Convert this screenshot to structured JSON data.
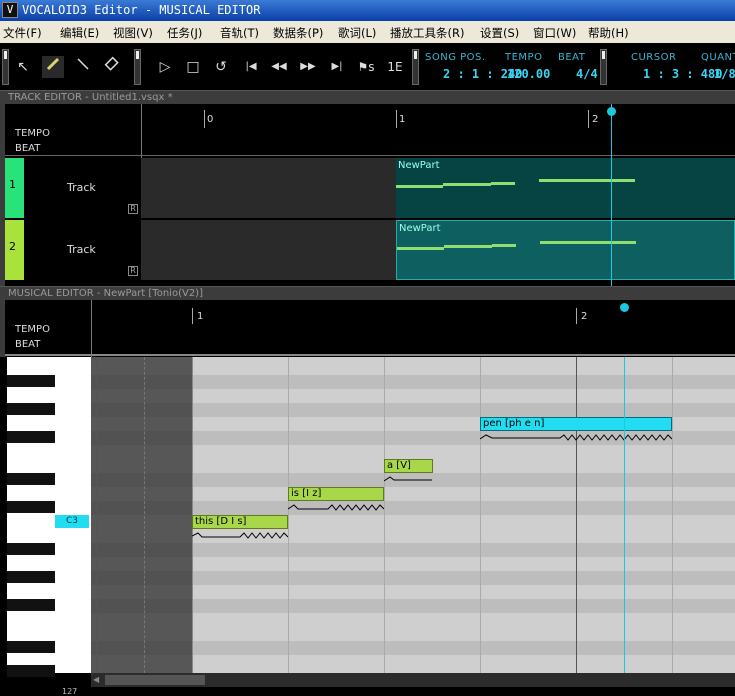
{
  "titlebar": {
    "title": "VOCALOID3 Editor - MUSICAL EDITOR",
    "logo": "V"
  },
  "menu": [
    "文件(F)",
    "编辑(E)",
    "视图(V)",
    "任务(J)",
    "音轨(T)",
    "数据条(P)",
    "歌词(L)",
    "播放工具条(R)",
    "设置(S)",
    "窗口(W)",
    "帮助(H)"
  ],
  "transport": {
    "song_pos_label": "SONG POS.",
    "song_pos": "2 : 1 : 240",
    "tempo_label": "TEMPO",
    "tempo": "120.00",
    "beat_label": "BEAT",
    "beat": "4/4",
    "cursor_label": "CURSOR",
    "cursor": "1 : 3 : 480",
    "quant_label": "QUANT",
    "quant": "1/8"
  },
  "track_editor": {
    "header": "TRACK EDITOR - Untitled1.vsqx *",
    "tempo_label": "TEMPO",
    "beat_label": "BEAT",
    "ruler": [
      "0",
      "1",
      "2"
    ],
    "tracks": [
      {
        "num": "1",
        "name": "Track",
        "r": "R",
        "part": "NewPart",
        "color": "#2ae27a"
      },
      {
        "num": "2",
        "name": "Track",
        "r": "R",
        "part": "NewPart",
        "color": "#a8e23a"
      }
    ]
  },
  "musical_editor": {
    "header": "MUSICAL EDITOR - NewPart [Tonio(V2)]",
    "tempo_label": "TEMPO",
    "beat_label": "BEAT",
    "ruler": [
      "1",
      "2"
    ],
    "key_label": "C3",
    "notes": [
      "this [D I s]",
      "is [I z]",
      "a [V]",
      "pen [ph e n]"
    ],
    "bottom_value": "127"
  },
  "colors": {
    "cursor": "#1cc8e0",
    "note": "#a8d84a",
    "note_selected": "#22dcf2",
    "part_bg": "#064343"
  }
}
